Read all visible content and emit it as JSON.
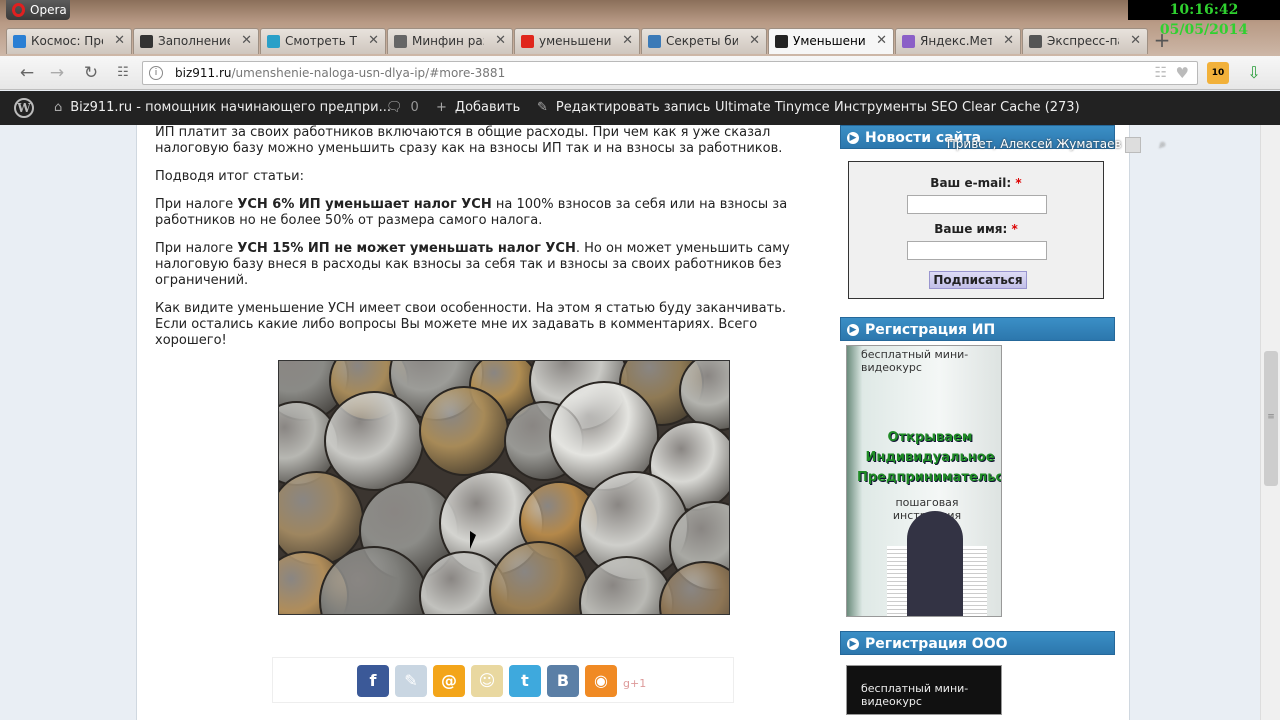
{
  "browser": {
    "app_name": "Opera",
    "clock": "10:16:42  05/05/2014",
    "tabs": [
      {
        "label": "Космос: Пре",
        "icon": "globe-icon",
        "color": "#2a7fd4"
      },
      {
        "label": "Заполнение",
        "icon": "play-icon",
        "color": "#333333"
      },
      {
        "label": "Смотреть ТВ",
        "icon": "globe-icon",
        "color": "#2aa0c8"
      },
      {
        "label": "Минфин раз",
        "icon": "crest-icon",
        "color": "#666666"
      },
      {
        "label": "уменьшение",
        "icon": "yandex-icon",
        "color": "#e0261c"
      },
      {
        "label": "Секреты биз",
        "icon": "b-icon",
        "color": "#3c7ab7"
      },
      {
        "label": "Уменьшение",
        "icon": "site-icon",
        "color": "#222222",
        "active": true
      },
      {
        "label": "Яндекс.Метр",
        "icon": "metrika-icon",
        "color": "#8b5fc7"
      },
      {
        "label": "Экспресс-па",
        "icon": "grid-icon",
        "color": "#555555"
      }
    ],
    "url_domain": "biz911.ru",
    "url_path": "/umenshenie-naloga-usn-dlya-ip/#more-3881",
    "ext_badge": "10"
  },
  "adminbar": {
    "site": "Biz911.ru - помощник начинающего предпри...",
    "comments": "0",
    "add": "Добавить",
    "edit": "Редактировать запись",
    "tinymce": "Ultimate Tinymce",
    "seo": "Инструменты SEO",
    "cache": "Clear Cache (273)",
    "greeting": "Привет, Алексей Жуматаев"
  },
  "article": {
    "p1": "ИП платит за своих работников включаются в общие расходы. При чем как я уже сказал налоговую базу можно уменьшить сразу как на взносы ИП так и на взносы за работников.",
    "p2": "Подводя итог статьи:",
    "p3_pre": "При налоге ",
    "p3_bold": "УСН 6% ИП уменьшает налог УСН",
    "p3_post": " на 100% взносов за себя или на взносы за работников но не более 50% от размера самого налога.",
    "p4_pre": "При налоге ",
    "p4_bold": "УСН 15% ИП не может уменьшать налог УСН",
    "p4_post": ". Но он может уменьшить саму налоговую базу внеся в расходы как взносы за себя так и взносы за своих работников без ограничений.",
    "p5": "Как видите уменьшение УСН имеет свои особенности. На этом я статью буду заканчивать. Если остались какие либо вопросы Вы можете мне их задавать в комментариях. Всего хорошего!"
  },
  "share": {
    "buttons": [
      {
        "name": "facebook",
        "glyph": "f",
        "color": "#3b5998"
      },
      {
        "name": "livejournal",
        "glyph": "✎",
        "color": "#c9d6e2"
      },
      {
        "name": "mailru",
        "glyph": "@",
        "color": "#f3a51a"
      },
      {
        "name": "odnoklassniki",
        "glyph": "☺",
        "color": "#e9d8a0"
      },
      {
        "name": "twitter",
        "glyph": "t",
        "color": "#3ea9dd"
      },
      {
        "name": "vkontakte",
        "glyph": "B",
        "color": "#5b7fa6"
      },
      {
        "name": "rss",
        "glyph": "◉",
        "color": "#f08a24"
      }
    ],
    "gplus": "g+1"
  },
  "sidebar": {
    "news_title": "Новости сайта",
    "email_label": "Ваш e-mail:",
    "name_label": "Ваше имя:",
    "required_mark": "*",
    "subscribe_btn": "Подписаться",
    "ip_title": "Регистрация ИП",
    "ip_box_top": "бесплатный мини-видеокурс",
    "ip_box_title": "Открываем Индивидуальное Предпринимательство",
    "ip_box_sub": "пошаговая инструкция",
    "ooo_title": "Регистрация ООО",
    "ooo_box_top": "бесплатный мини-видеокурс"
  }
}
